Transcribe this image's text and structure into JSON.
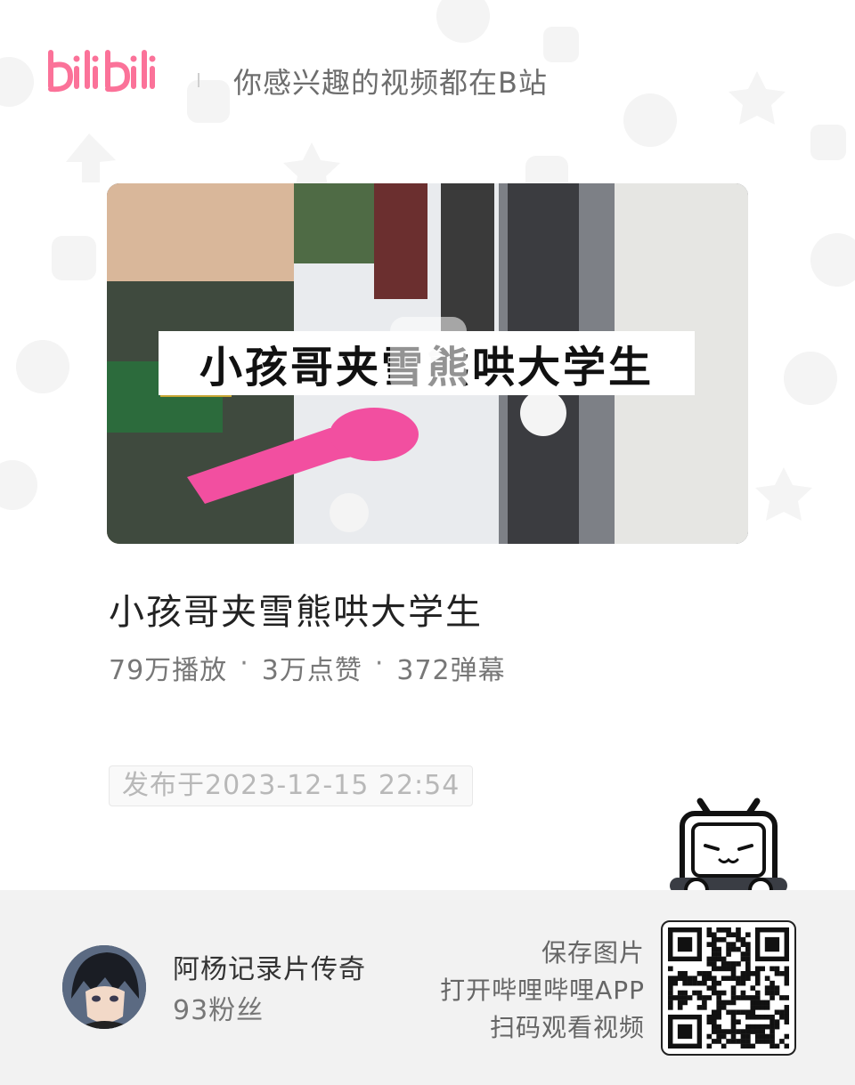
{
  "header": {
    "logo_text": "bilibili",
    "slogan": "你感兴趣的视频都在B站"
  },
  "video": {
    "cover_caption": "小孩哥夹雪熊哄大学生",
    "title": "小孩哥夹雪熊哄大学生",
    "stats": {
      "plays": "79万播放",
      "likes": "3万点赞",
      "danmaku": "372弹幕",
      "separator": "·"
    },
    "publish_time": "发布于2023-12-15 22:54"
  },
  "uploader": {
    "name": "阿杨记录片传奇",
    "fans": "93粉丝"
  },
  "qr": {
    "line1": "保存图片",
    "line2": "打开哔哩哔哩APP",
    "line3": "扫码观看视频"
  },
  "colors": {
    "brand_pink": "#fb7299",
    "footer_bg": "#f2f2f2",
    "text_primary": "#222222",
    "text_secondary": "#777777"
  },
  "icons": [
    "bilibili-logo",
    "bilibili-tv-mascot-icon",
    "qr-code-icon",
    "play-icon",
    "avatar-image"
  ]
}
